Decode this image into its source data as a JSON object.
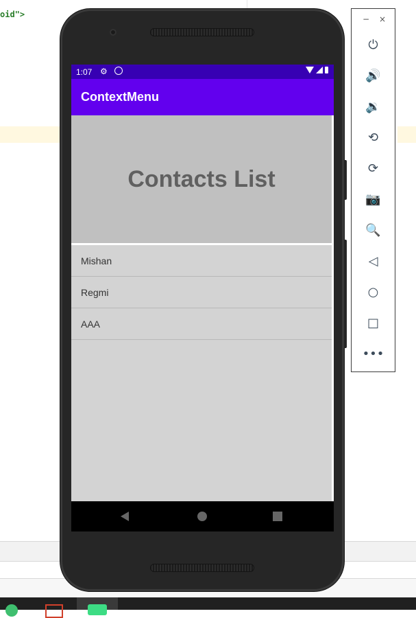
{
  "ide": {
    "code_snippet": "oid\">"
  },
  "phone": {
    "status_bar": {
      "time": "1:07"
    },
    "app_bar": {
      "title": "ContextMenu"
    },
    "header": {
      "title": "Contacts List"
    },
    "contacts": [
      {
        "label": "Mishan"
      },
      {
        "label": "Regmi"
      },
      {
        "label": "AAA"
      }
    ],
    "nav_buttons": [
      "back-icon",
      "home-icon",
      "recents-icon"
    ]
  },
  "emulator_toolbar": {
    "window_controls": {
      "minimize": "−",
      "close": "×"
    },
    "buttons": [
      {
        "icon": "power-icon",
        "glyph": "⏻"
      },
      {
        "icon": "volume-up-icon",
        "glyph": "🔊"
      },
      {
        "icon": "volume-down-icon",
        "glyph": "🔉"
      },
      {
        "icon": "rotate-left-icon",
        "glyph": "⟲"
      },
      {
        "icon": "rotate-right-icon",
        "glyph": "⟳"
      },
      {
        "icon": "camera-icon",
        "glyph": "📷"
      },
      {
        "icon": "zoom-icon",
        "glyph": "🔍"
      },
      {
        "icon": "back-icon",
        "glyph": "◁"
      },
      {
        "icon": "home-icon",
        "glyph": "○"
      },
      {
        "icon": "overview-icon",
        "glyph": "□"
      },
      {
        "icon": "more-icon",
        "glyph": "•••"
      }
    ]
  },
  "colors": {
    "status_bar": "#3700b3",
    "app_bar": "#6200ee",
    "header_bg": "#c0c0c0",
    "screen_bg": "#d3d3d3"
  }
}
